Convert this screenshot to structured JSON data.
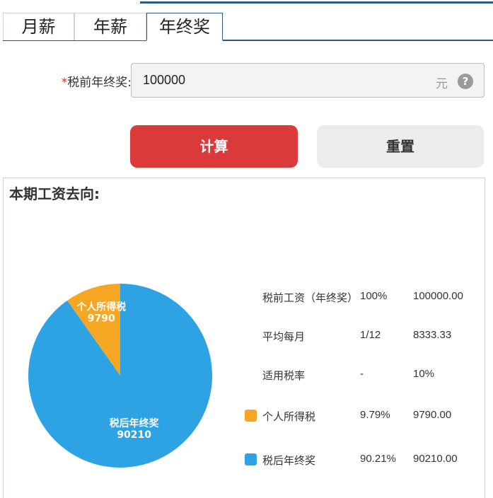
{
  "tabs": [
    {
      "label": "月薪",
      "active": false
    },
    {
      "label": "年薪",
      "active": false
    },
    {
      "label": "年终奖",
      "active": true
    }
  ],
  "form": {
    "required_mark": "*",
    "label": "税前年终奖:",
    "value": "100000",
    "unit": "元",
    "help_icon": "?"
  },
  "buttons": {
    "calculate": "计算",
    "reset": "重置"
  },
  "result": {
    "title": "本期工资去向:",
    "rows": [
      {
        "label": "税前工资（年终奖）",
        "percent": "100%",
        "amount": "100000.00"
      },
      {
        "label": "平均每月",
        "percent": "1/12",
        "amount": "8333.33"
      },
      {
        "label": "适用税率",
        "percent": "-",
        "amount": "10%"
      },
      {
        "label": "个人所得税",
        "percent": "9.79%",
        "amount": "9790.00",
        "color": "#f5a623"
      },
      {
        "label": "税后年终奖",
        "percent": "90.21%",
        "amount": "90210.00",
        "color": "#2ea3e3"
      }
    ]
  },
  "chart_data": {
    "type": "pie",
    "slices": [
      {
        "label": "个人所得税",
        "value": 9790,
        "color": "#f5a623"
      },
      {
        "label": "税后年终奖",
        "value": 90210,
        "color": "#2ea3e3"
      }
    ]
  }
}
